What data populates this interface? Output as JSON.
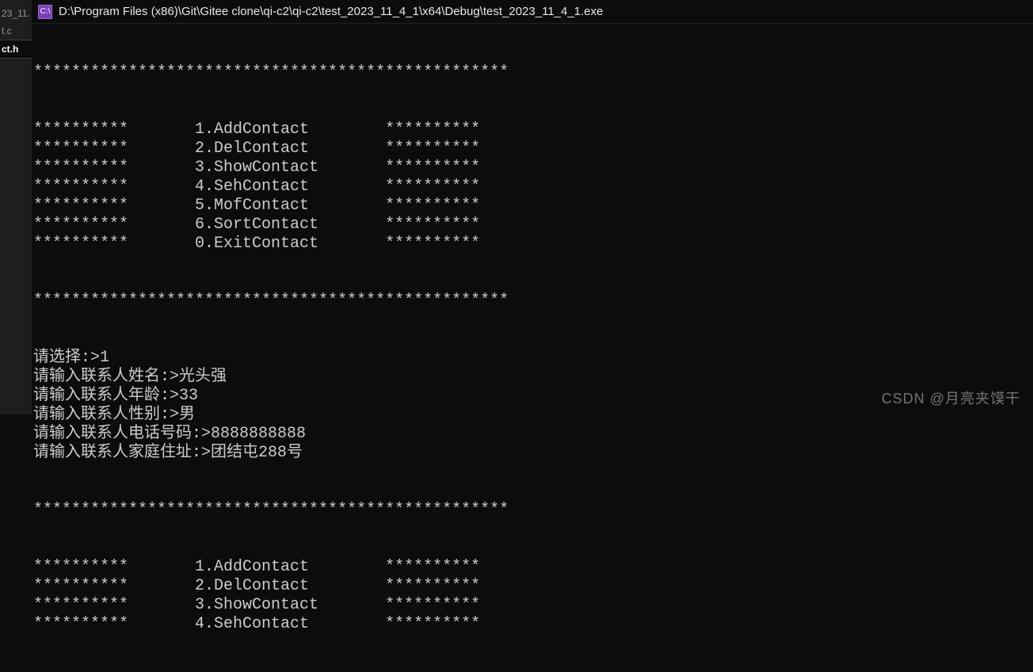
{
  "editor_tabs": {
    "fragment1": "23_11.",
    "fragment2": "t.c",
    "fragment3_active": "ct.h"
  },
  "window": {
    "icon_label": "C:\\",
    "title": "D:\\Program Files (x86)\\Git\\Gitee clone\\qi-c2\\qi-c2\\test_2023_11_4_1\\x64\\Debug\\test_2023_11_4_1.exe"
  },
  "console": {
    "border_full": "**************************************************",
    "menu": [
      {
        "left": "**********",
        "num": "1.",
        "label": "AddContact",
        "right": "**********"
      },
      {
        "left": "**********",
        "num": "2.",
        "label": "DelContact",
        "right": "**********"
      },
      {
        "left": "**********",
        "num": "3.",
        "label": "ShowContact",
        "right": "**********"
      },
      {
        "left": "**********",
        "num": "4.",
        "label": "SehContact",
        "right": "**********"
      },
      {
        "left": "**********",
        "num": "5.",
        "label": "MofContact",
        "right": "**********"
      },
      {
        "left": "**********",
        "num": "6.",
        "label": "SortContact",
        "right": "**********"
      },
      {
        "left": "**********",
        "num": "0.",
        "label": "ExitContact",
        "right": "**********"
      }
    ],
    "prompts": [
      {
        "prompt": "请选择:>",
        "input": "1"
      },
      {
        "prompt": "请输入联系人姓名:>",
        "input": "光头强"
      },
      {
        "prompt": "请输入联系人年龄:>",
        "input": "33"
      },
      {
        "prompt": "请输入联系人性别:>",
        "input": "男"
      },
      {
        "prompt": "请输入联系人电话号码:>",
        "input": "8888888888"
      },
      {
        "prompt": "请输入联系人家庭住址:>",
        "input": "团结屯288号"
      }
    ],
    "menu2": [
      {
        "left": "**********",
        "num": "1.",
        "label": "AddContact",
        "right": "**********"
      },
      {
        "left": "**********",
        "num": "2.",
        "label": "DelContact",
        "right": "**********"
      },
      {
        "left": "**********",
        "num": "3.",
        "label": "ShowContact",
        "right": "**********"
      },
      {
        "left": "**********",
        "num": "4.",
        "label": "SehContact",
        "right": "**********"
      }
    ]
  },
  "watermark": "CSDN @月亮夹馍干"
}
